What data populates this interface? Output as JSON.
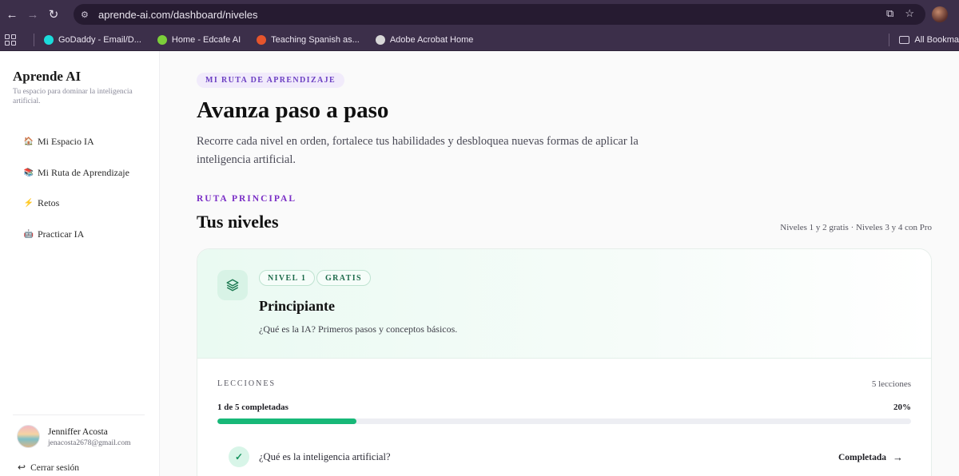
{
  "browser": {
    "url": "aprende-ai.com/dashboard/niveles",
    "bookmarks": [
      {
        "label": "GoDaddy - Email/D...",
        "color": "#1bdbdb"
      },
      {
        "label": "Home - Edcafe AI",
        "color": "#7ccf3a"
      },
      {
        "label": "Teaching Spanish as...",
        "color": "#e6552c"
      },
      {
        "label": "Adobe Acrobat Home",
        "color": "#d7d7d7"
      }
    ],
    "all_bookmarks": "All Bookma"
  },
  "sidebar": {
    "brand": "Aprende AI",
    "tagline": "Tu espacio para dominar la inteligencia artificial.",
    "items": [
      {
        "label": "Mi Espacio IA",
        "icon": "house-icon"
      },
      {
        "label": "Mi Ruta de Aprendizaje",
        "icon": "books-icon"
      },
      {
        "label": "Retos",
        "icon": "lightning-icon"
      },
      {
        "label": "Practicar IA",
        "icon": "robot-icon"
      }
    ],
    "user": {
      "name": "Jenniffer Acosta",
      "email": "jenacosta2678@gmail.com"
    },
    "logout": "Cerrar sesión"
  },
  "main": {
    "pill": "MI RUTA DE APRENDIZAJE",
    "title": "Avanza paso a paso",
    "intro": "Recorre cada nivel en orden, fortalece tus habilidades y desbloquea nuevas formas de aplicar la inteligencia artificial.",
    "kicker": "RUTA PRINCIPAL",
    "section_title": "Tus niveles",
    "levels_note": "Niveles 1 y 2 gratis · Niveles 3 y 4 con Pro",
    "level": {
      "tag_level": "NIVEL 1",
      "tag_free": "GRATIS",
      "title": "Principiante",
      "description": "¿Qué es la IA? Primeros pasos y conceptos básicos.",
      "lessons_label": "LECCIONES",
      "lessons_count": "5 lecciones",
      "progress_label": "1 de 5 completadas",
      "progress_pct": "20%",
      "progress_value": 0.2,
      "lessons": [
        {
          "title": "¿Qué es la inteligencia artificial?",
          "status": "Completada"
        }
      ]
    }
  },
  "colors": {
    "accent": "#17b878",
    "purple": "#7a2ec6"
  }
}
